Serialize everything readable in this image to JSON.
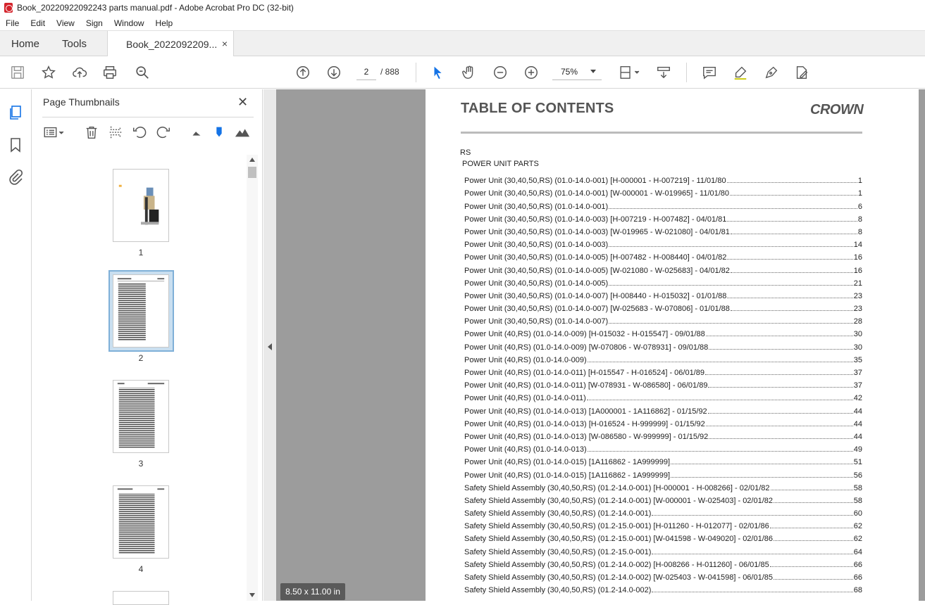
{
  "window": {
    "title": "Book_20220922092243 parts manual.pdf - Adobe Acrobat Pro DC (32-bit)"
  },
  "menu": [
    "File",
    "Edit",
    "View",
    "Sign",
    "Window",
    "Help"
  ],
  "tabs": {
    "home": "Home",
    "tools": "Tools",
    "doc": "Book_2022092209...",
    "close": "×"
  },
  "toolbar": {
    "page_current": "2",
    "page_total": "/ 888",
    "zoom": "75%"
  },
  "panel": {
    "title": "Page Thumbnails",
    "close": "✕",
    "thumbnails": [
      "1",
      "2",
      "3",
      "4"
    ]
  },
  "status": {
    "page_size": "8.50 x 11.00 in"
  },
  "document": {
    "heading": "TABLE OF CONTENTS",
    "brand": "CROWN",
    "section": "RS",
    "subsection": "POWER UNIT PARTS",
    "entries": [
      {
        "text": "Power Unit (30,40,50,RS) (01.0-14.0-001)  [H-000001 - H-007219] - 11/01/80",
        "page": "1"
      },
      {
        "text": "Power Unit (30,40,50,RS) (01.0-14.0-001)  [W-000001 - W-019965] - 11/01/80",
        "page": "1"
      },
      {
        "text": "Power Unit (30,40,50,RS) (01.0-14.0-001)",
        "page": "6"
      },
      {
        "text": "Power Unit (30,40,50,RS) (01.0-14.0-003)  [H-007219 - H-007482] - 04/01/81",
        "page": "8"
      },
      {
        "text": "Power Unit (30,40,50,RS) (01.0-14.0-003)  [W-019965 - W-021080] - 04/01/81",
        "page": "8"
      },
      {
        "text": "Power Unit (30,40,50,RS) (01.0-14.0-003)",
        "page": "14"
      },
      {
        "text": "Power Unit (30,40,50,RS) (01.0-14.0-005)  [H-007482 - H-008440] - 04/01/82",
        "page": "16"
      },
      {
        "text": "Power Unit (30,40,50,RS) (01.0-14.0-005)  [W-021080 - W-025683] - 04/01/82",
        "page": "16"
      },
      {
        "text": "Power Unit (30,40,50,RS) (01.0-14.0-005)",
        "page": "21"
      },
      {
        "text": "Power Unit (30,40,50,RS) (01.0-14.0-007)  [H-008440 - H-015032] - 01/01/88",
        "page": "23"
      },
      {
        "text": "Power Unit (30,40,50,RS) (01.0-14.0-007)  [W-025683 - W-070806] - 01/01/88",
        "page": "23"
      },
      {
        "text": "Power Unit (30,40,50,RS) (01.0-14.0-007)",
        "page": "28"
      },
      {
        "text": "Power Unit (40,RS) (01.0-14.0-009)  [H-015032 - H-015547] - 09/01/88",
        "page": "30"
      },
      {
        "text": "Power Unit (40,RS) (01.0-14.0-009)  [W-070806 - W-078931] - 09/01/88",
        "page": "30"
      },
      {
        "text": "Power Unit (40,RS) (01.0-14.0-009)",
        "page": "35"
      },
      {
        "text": "Power Unit (40,RS) (01.0-14.0-011)  [H-015547 - H-016524] - 06/01/89",
        "page": "37"
      },
      {
        "text": "Power Unit (40,RS) (01.0-14.0-011)  [W-078931 - W-086580] - 06/01/89",
        "page": "37"
      },
      {
        "text": "Power Unit (40,RS) (01.0-14.0-011)",
        "page": "42"
      },
      {
        "text": "Power Unit (40,RS) (01.0-14.0-013)  [1A000001 - 1A116862] - 01/15/92",
        "page": "44"
      },
      {
        "text": "Power Unit (40,RS) (01.0-14.0-013)  [H-016524 - H-999999] - 01/15/92",
        "page": "44"
      },
      {
        "text": "Power Unit (40,RS) (01.0-14.0-013)  [W-086580 - W-999999] - 01/15/92",
        "page": "44"
      },
      {
        "text": "Power Unit (40,RS) (01.0-14.0-013)",
        "page": "49"
      },
      {
        "text": "Power Unit (40,RS) (01.0-14.0-015)  [1A116862 - 1A999999]",
        "page": "51"
      },
      {
        "text": "Power Unit (40,RS) (01.0-14.0-015)  [1A116862 - 1A999999]",
        "page": "56"
      },
      {
        "text": "Safety Shield Assembly (30,40,50,RS) (01.2-14.0-001)  [H-000001 - H-008266] - 02/01/82",
        "page": "58"
      },
      {
        "text": "Safety Shield Assembly (30,40,50,RS) (01.2-14.0-001)  [W-000001 - W-025403] - 02/01/82",
        "page": "58"
      },
      {
        "text": "Safety Shield Assembly (30,40,50,RS) (01.2-14.0-001)",
        "page": "60"
      },
      {
        "text": "Safety Shield Assembly (30,40,50,RS) (01.2-15.0-001)  [H-011260 - H-012077] - 02/01/86",
        "page": "62"
      },
      {
        "text": "Safety Shield Assembly (30,40,50,RS) (01.2-15.0-001)  [W-041598 - W-049020] - 02/01/86",
        "page": "62"
      },
      {
        "text": "Safety Shield Assembly (30,40,50,RS) (01.2-15.0-001)",
        "page": "64"
      },
      {
        "text": "Safety Shield Assembly (30,40,50,RS) (01.2-14.0-002)  [H-008266 - H-011260] - 06/01/85",
        "page": "66"
      },
      {
        "text": "Safety Shield Assembly (30,40,50,RS) (01.2-14.0-002)  [W-025403 - W-041598] - 06/01/85",
        "page": "66"
      },
      {
        "text": "Safety Shield Assembly (30,40,50,RS) (01.2-14.0-002)",
        "page": "68"
      }
    ]
  }
}
